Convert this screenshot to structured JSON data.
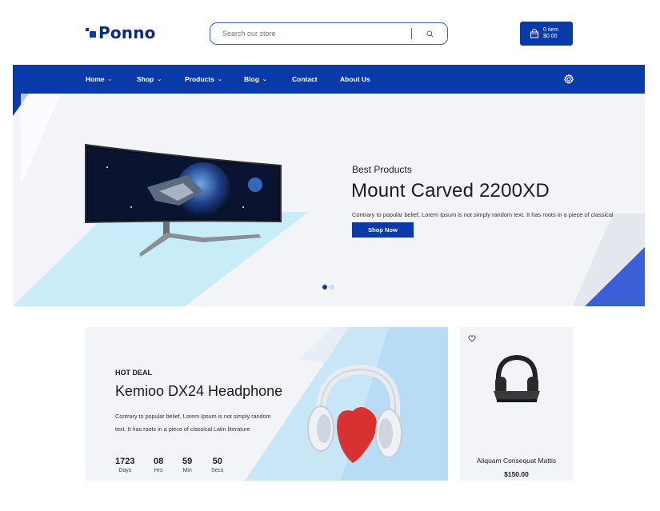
{
  "brand": {
    "name": "Ponno",
    "color": "#0a3aa8"
  },
  "search": {
    "placeholder": "Search our store",
    "icon": "search-icon"
  },
  "cart": {
    "items": "0 item",
    "total": "$0.00",
    "icon": "shopping-bag-icon"
  },
  "nav": {
    "items": [
      {
        "label": "Home",
        "dropdown": true
      },
      {
        "label": "Shop",
        "dropdown": true
      },
      {
        "label": "Products",
        "dropdown": true
      },
      {
        "label": "Blog",
        "dropdown": true
      },
      {
        "label": "Contact",
        "dropdown": false
      },
      {
        "label": "About Us",
        "dropdown": false
      }
    ],
    "settings_icon": "gear-icon"
  },
  "hero": {
    "subtitle": "Best Products",
    "title": "Mount Carved 2200XD",
    "description": "Contrary to popular belief, Lorem Ipsum is not simply random text. It has roots in a piece of classical",
    "button": "Shop Now",
    "slides": 2,
    "active_slide": 1
  },
  "deal": {
    "tag": "HOT DEAL",
    "title": "Kemioo DX24 Headphone",
    "description": "Contrary to popular belief, Lorem Ipsum is not simply random text. It has roots in a piece of classical Latin literature",
    "countdown": [
      {
        "value": "1723",
        "label": "Days"
      },
      {
        "value": "08",
        "label": "Hrs"
      },
      {
        "value": "59",
        "label": "Min"
      },
      {
        "value": "50",
        "label": "Secs"
      }
    ]
  },
  "product": {
    "name": "Aliquam Consequat Mattis",
    "price": "$150.00",
    "wishlist_icon": "heart-icon"
  }
}
